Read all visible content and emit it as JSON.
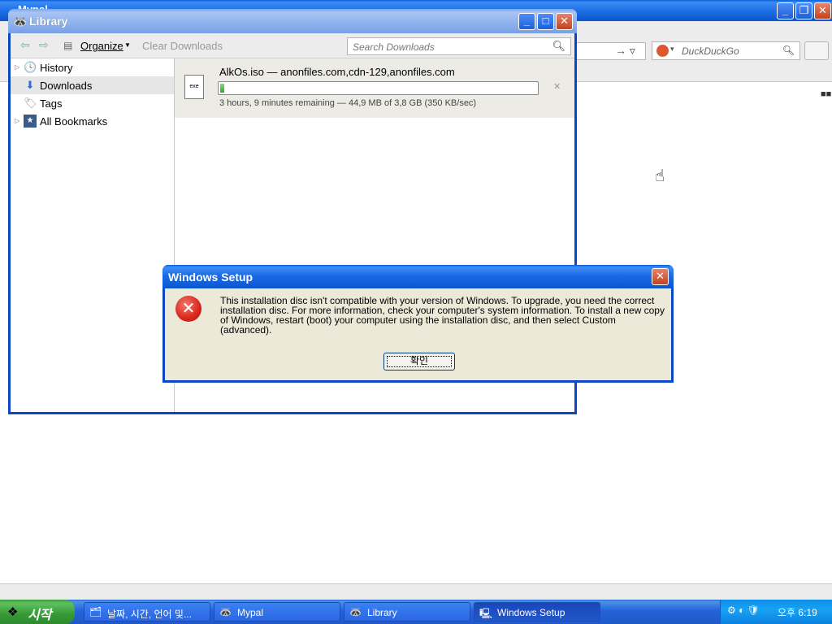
{
  "browser": {
    "title": "Mypal",
    "search_placeholder": "DuckDuckGo"
  },
  "library": {
    "title": "Library",
    "toolbar": {
      "organize_label": "Organize",
      "clear_downloads_label": "Clear Downloads",
      "search_placeholder": "Search Downloads"
    },
    "sidebar": [
      {
        "label": "History",
        "icon": "clock-icon",
        "expandable": true
      },
      {
        "label": "Downloads",
        "icon": "download-arrow-icon",
        "selected": true
      },
      {
        "label": "Tags",
        "icon": "tag-icon"
      },
      {
        "label": "All Bookmarks",
        "icon": "star-icon",
        "expandable": true
      }
    ],
    "download": {
      "name": "AlkOs.iso — anonfiles.com,cdn-129,anonfiles.com",
      "status": "3 hours, 9 minutes remaining — 44,9 MB of 3,8 GB (350 KB/sec)",
      "progress": 0.012,
      "file_icon_text": "exe"
    }
  },
  "dialog": {
    "title": "Windows Setup",
    "message": "This installation disc isn't compatible with your version of Windows. To upgrade, you need the correct installation disc. For more information, check your computer's system information. To install a new copy of Windows, restart (boot) your computer using the installation disc, and then select Custom (advanced).",
    "ok_label": "확인"
  },
  "taskbar": {
    "start_label": "시작",
    "tasks": [
      {
        "label": "날짜, 시간, 언어 및...",
        "icon": "control-panel-icon"
      },
      {
        "label": "Mypal",
        "icon": "mypal-icon"
      },
      {
        "label": "Library",
        "icon": "mypal-icon"
      },
      {
        "label": "Windows Setup",
        "icon": "setup-icon",
        "active": true
      }
    ],
    "clock": "오후 6:19"
  },
  "colors": {
    "xp_title_blue": "#0a5fd8",
    "start_green": "#3c9c3c",
    "progress_green": "#2ea82e",
    "error_red": "#d8261a"
  }
}
